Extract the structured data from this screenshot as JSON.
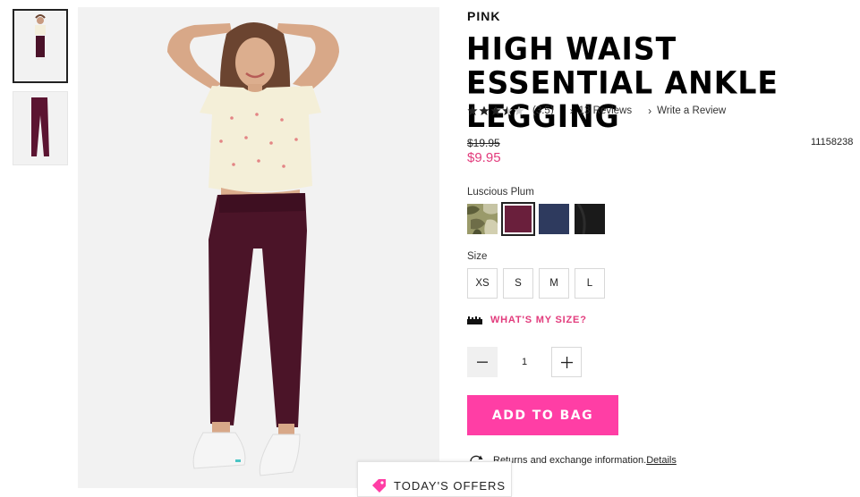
{
  "thumbnails": [
    {
      "alt": "model wearing legging"
    },
    {
      "alt": "legging flat view"
    }
  ],
  "product": {
    "brand": "PINK",
    "title": "HIGH WAIST ESSENTIAL ANKLE LEGGING",
    "rating": 3.5,
    "rating_text": "(3.5)",
    "reviews_link": "13 Reviews",
    "write_review_link": "Write a Review",
    "original_price": "$19.95",
    "sale_price": "$9.95",
    "sku": "11158238",
    "selected_color_name": "Luscious Plum",
    "colors": [
      {
        "name": "camo",
        "hex": "#8a8a5c",
        "selected": false
      },
      {
        "name": "plum",
        "hex": "#6a1f3c",
        "selected": true
      },
      {
        "name": "navy",
        "hex": "#2e3a5e",
        "selected": false
      },
      {
        "name": "black",
        "hex": "#1a1a1a",
        "selected": false
      }
    ],
    "size_label": "Size",
    "sizes": [
      "XS",
      "S",
      "M",
      "L"
    ],
    "size_guide_text": "WHAT'S MY SIZE?",
    "quantity": "1",
    "add_to_bag": "ADD TO BAG",
    "returns_text": "Returns and exchange information.",
    "returns_link": "Details"
  },
  "offers_tab": "TODAY'S OFFERS",
  "colors": {
    "accent_pink": "#ff3ea5",
    "price_pink": "#e23b7c"
  }
}
